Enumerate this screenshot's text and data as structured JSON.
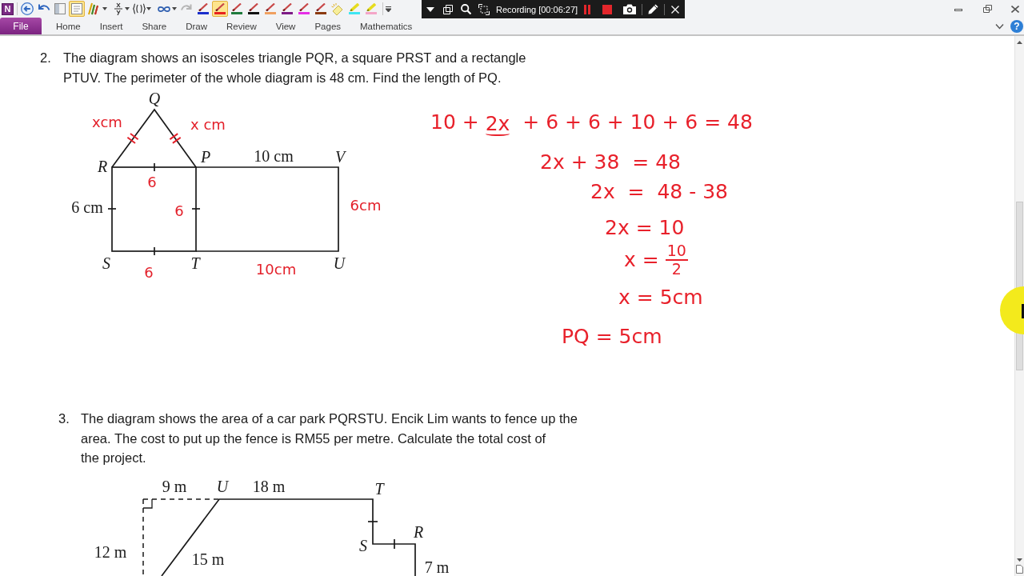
{
  "app": {
    "logo": "N"
  },
  "quick_access": {
    "views": [
      {
        "kind": "panes",
        "selected": false
      },
      {
        "kind": "page",
        "selected": true
      }
    ],
    "pens": [
      {
        "kind": "pen",
        "color": "#1a2ecc",
        "selected": false
      },
      {
        "kind": "pen",
        "color": "#e8231f",
        "selected": true
      },
      {
        "kind": "pen",
        "color": "#1f7a3c",
        "selected": false
      },
      {
        "kind": "pen",
        "color": "#111111",
        "selected": false
      },
      {
        "kind": "pen",
        "color": "#f0a060",
        "selected": false
      },
      {
        "kind": "pen",
        "color": "#7d1a86",
        "selected": false
      },
      {
        "kind": "pen",
        "color": "#e62ee6",
        "selected": false
      },
      {
        "kind": "pen",
        "color": "#8b3a10",
        "selected": false
      },
      {
        "kind": "eraser",
        "selected": false
      },
      {
        "kind": "highlighter",
        "color": "#3ee6f2",
        "selected": false
      },
      {
        "kind": "highlighter",
        "color": "#f4a6c8",
        "selected": false
      }
    ]
  },
  "recorder": {
    "label": "Recording [00:06:27]"
  },
  "ribbon": {
    "file": "File",
    "tabs": [
      {
        "label": "Home",
        "selected": false
      },
      {
        "label": "Insert",
        "selected": false
      },
      {
        "label": "Share",
        "selected": false
      },
      {
        "label": "Draw",
        "selected": false
      },
      {
        "label": "Review",
        "selected": false
      },
      {
        "label": "View",
        "selected": false
      },
      {
        "label": "Pages",
        "selected": false
      },
      {
        "label": "Mathematics",
        "selected": false
      }
    ],
    "help": "?"
  },
  "page": {
    "questions": [
      {
        "number": "2.",
        "text": "The diagram shows an isosceles triangle PQR, a square PRST and a rectangle\nPTUV. The perimeter of the whole diagram is 48 cm. Find the length of PQ.",
        "figure": {
          "kind": "composite",
          "vertex_labels": [
            "Q",
            "R",
            "P",
            "V",
            "S",
            "T",
            "U"
          ],
          "length_labels": [
            "10 cm",
            "6 cm"
          ],
          "annotations": [
            "xcm",
            "x cm",
            "6",
            "6",
            "6cm",
            "6",
            "10cm"
          ]
        },
        "working": [
          {
            "kind": "equation",
            "parts": [
              {
                "text": "10 + ",
                "underlined": false
              },
              {
                "text": "2x",
                "underlined": true
              },
              {
                "text": "  + 6 + 6 + 10 + 6 = 48",
                "underlined": false
              }
            ]
          },
          {
            "kind": "equation",
            "parts": [
              {
                "text": "2x + 38  = 48",
                "underlined": false
              }
            ]
          },
          {
            "kind": "equation",
            "parts": [
              {
                "text": "2x  =  48 - 38",
                "underlined": false
              }
            ]
          },
          {
            "kind": "equation",
            "parts": [
              {
                "text": "2x = 10",
                "underlined": false
              }
            ]
          },
          {
            "kind": "fraction",
            "parts": [
              {
                "text": "x = ",
                "underlined": false
              }
            ],
            "numerator": "10",
            "denominator": "2"
          },
          {
            "kind": "equation",
            "parts": [
              {
                "text": "x = 5cm",
                "underlined": false
              }
            ]
          },
          {
            "kind": "equation",
            "parts": [
              {
                "text": "PQ = 5cm",
                "underlined": false
              }
            ]
          }
        ]
      },
      {
        "number": "3.",
        "text": "The diagram shows the area of a car park PQRSTU. Encik Lim wants to fence up the\narea. The cost to put up the fence is RM55 per metre. Calculate the total cost of\nthe project.",
        "figure": {
          "kind": "carpark",
          "vertex_labels": [
            "U",
            "T",
            "S",
            "R"
          ],
          "length_labels": [
            "9 m",
            "18 m",
            "12 m",
            "15 m",
            "7 m"
          ]
        }
      }
    ]
  }
}
